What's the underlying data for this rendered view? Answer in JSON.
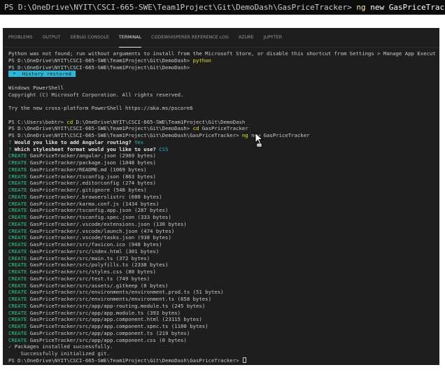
{
  "top_command": {
    "prompt": "PS D:\\OneDrive\\NYIT\\CSCI-665-SWE\\Team1Project\\Git\\DemoDash\\GasPriceTracker>",
    "ng": "ng",
    "rest": " new GasPriceTracker"
  },
  "tabs": [
    {
      "label": "PROBLEMS"
    },
    {
      "label": "OUTPUT"
    },
    {
      "label": "DEBUG CONSOLE"
    },
    {
      "label": "TERMINAL",
      "active": true
    },
    {
      "label": "CODEWHISPERER REFERENCE LOG"
    },
    {
      "label": "AZURE"
    },
    {
      "label": "JUPYTER"
    }
  ],
  "terminal": {
    "python_error": "Python was not found; run without arguments to install from the Microsoft Store, or disable this shortcut from Settings > Manage App Execution Aliases.",
    "prompt_demodash": "PS D:\\OneDrive\\NYIT\\CSCI-665-SWE\\Team1Project\\Git\\DemoDash>",
    "python_cmd": " python",
    "history_restored": " *  History restored ",
    "ps_title": "Windows PowerShell",
    "copyright": "Copyright (C) Microsoft Corporation. All rights reserved.",
    "try_new": "Try the new cross-platform PowerShell https://aka.ms/pscore6",
    "prompt_home": "PS C:\\Users\\bobtr>",
    "cd_cmd1": " cd",
    "cd_arg1": " D:\\OneDrive\\NYIT\\CSCI-665-SWE\\Team1Project\\Git\\DemoDash",
    "cd_cmd2": " cd",
    "cd_arg2": " GasPriceTracker",
    "prompt_gpt": "PS D:\\OneDrive\\NYIT\\CSCI-665-SWE\\Team1Project\\Git\\DemoDash\\GasPriceTracker>",
    "ng_cmd": " ng",
    "ng_args": " new GasPriceTracker",
    "q1_mark": "?",
    "q1_text": " Would you like to add Angular routing?",
    "q1_answer": " Yes",
    "q2_mark": "?",
    "q2_text": " Which stylesheet format would you like to use?",
    "q2_answer": " CSS",
    "create_word": "CREATE",
    "created_files": [
      "GasPriceTracker/angular.json (2969 bytes)",
      "GasPriceTracker/package.json (1048 bytes)",
      "GasPriceTracker/README.md (1069 bytes)",
      "GasPriceTracker/tsconfig.json (863 bytes)",
      "GasPriceTracker/.editorconfig (274 bytes)",
      "GasPriceTracker/.gitignore (548 bytes)",
      "GasPriceTracker/.browserslistrc (600 bytes)",
      "GasPriceTracker/karma.conf.js (1434 bytes)",
      "GasPriceTracker/tsconfig.app.json (287 bytes)",
      "GasPriceTracker/tsconfig.spec.json (333 bytes)",
      "GasPriceTracker/.vscode/extensions.json (130 bytes)",
      "GasPriceTracker/.vscode/launch.json (474 bytes)",
      "GasPriceTracker/.vscode/tasks.json (938 bytes)",
      "GasPriceTracker/src/favicon.ico (948 bytes)",
      "GasPriceTracker/src/index.html (301 bytes)",
      "GasPriceTracker/src/main.ts (372 bytes)",
      "GasPriceTracker/src/polyfills.ts (2338 bytes)",
      "GasPriceTracker/src/styles.css (80 bytes)",
      "GasPriceTracker/src/test.ts (749 bytes)",
      "GasPriceTracker/src/assets/.gitkeep (0 bytes)",
      "GasPriceTracker/src/environments/environment.prod.ts (51 bytes)",
      "GasPriceTracker/src/environments/environment.ts (658 bytes)",
      "GasPriceTracker/src/app/app-routing.module.ts (245 bytes)",
      "GasPriceTracker/src/app/app.module.ts (393 bytes)",
      "GasPriceTracker/src/app/app.component.html (23115 bytes)",
      "GasPriceTracker/src/app/app.component.spec.ts (1100 bytes)",
      "GasPriceTracker/src/app/app.component.ts (219 bytes)",
      "GasPriceTracker/src/app/app.component.css (0 bytes)"
    ],
    "check_mark": "✓",
    "packages_installed": " Packages installed successfully.",
    "git_init": "    Successfully initialized git."
  }
}
